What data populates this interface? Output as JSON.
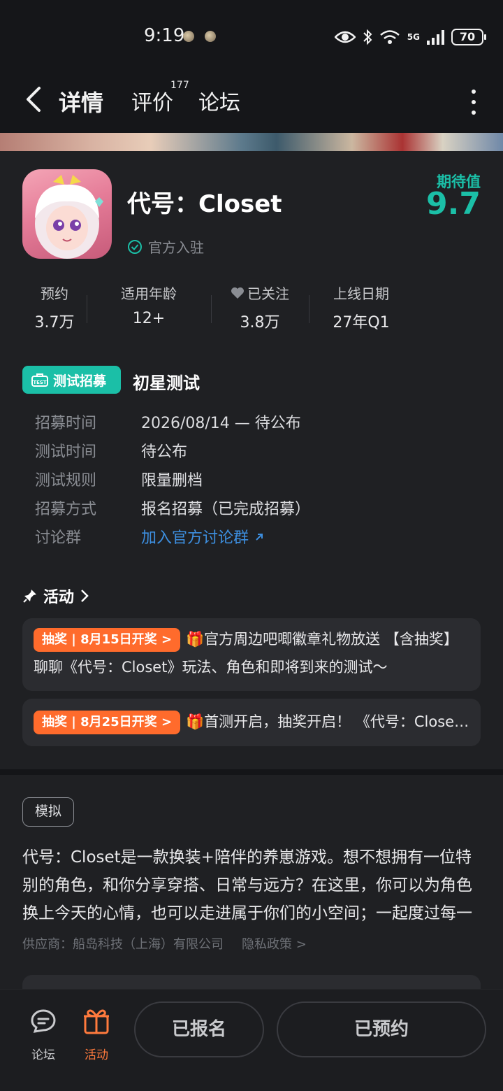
{
  "status": {
    "time": "9:19",
    "battery": "70",
    "network": "5G"
  },
  "nav": {
    "tabs": {
      "detail": "详情",
      "review": "评价",
      "review_count": "177",
      "forum": "论坛"
    }
  },
  "game": {
    "title": "代号：Closet",
    "official_label": "官方入驻",
    "expect_label": "期待值",
    "expect_value": "9.7",
    "stats": [
      {
        "label": "预约",
        "value": "3.7万"
      },
      {
        "label": "适用年龄",
        "value": "12+"
      },
      {
        "label": "已关注",
        "value": "3.8万"
      },
      {
        "label": "上线日期",
        "value": "27年Q1"
      }
    ]
  },
  "test": {
    "badge": "测试招募",
    "name": "初星测试",
    "rows": [
      {
        "key": "招募时间",
        "value": "2026/08/14 — 待公布"
      },
      {
        "key": "测试时间",
        "value": "待公布"
      },
      {
        "key": "测试规则",
        "value": "限量删档"
      },
      {
        "key": "招募方式",
        "value": "报名招募（已完成招募）"
      },
      {
        "key": "讨论群",
        "value": "加入官方讨论群"
      }
    ]
  },
  "activity": {
    "heading": "活动",
    "items": [
      {
        "tag": "抽奖 | 8月15日开奖 >",
        "text": "🎁官方周边吧唧徽章礼物放送 【含抽奖】聊聊《代号：Closet》玩法、角色和即将到来的测试～"
      },
      {
        "tag": "抽奖 | 8月25日开奖 >",
        "text": "🎁首测开启，抽奖开启！ 《代号：Closet》"
      }
    ]
  },
  "about": {
    "genre": "模拟",
    "description": "代号：Closet是一款换装+陪伴的养崽游戏。想不想拥有一位特别的角色，和你分享穿搭、日常与远方？在这里，你可以为角色换上今天的心情，也可以走进属于你们的小空间；一起度过每一天。",
    "supplier": "供应商：船岛科技（上海）有限公司",
    "privacy": "隐私政策 >"
  },
  "bottom": {
    "forum_label": "论坛",
    "activity_label": "活动",
    "registered_label": "已报名",
    "reserved_label": "已预约"
  },
  "colors": {
    "accent": "#1bbfa7",
    "orange": "#ff6b2c",
    "link": "#3d8fe0",
    "background": "#1f2023"
  }
}
